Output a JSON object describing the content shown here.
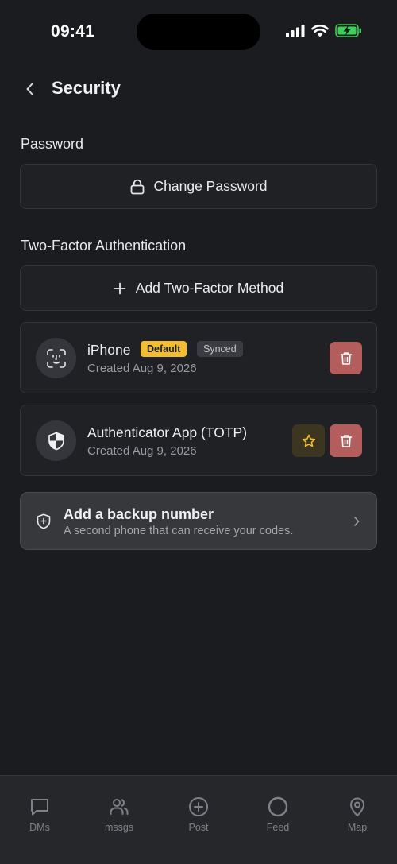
{
  "status_bar": {
    "time": "09:41"
  },
  "header": {
    "title": "Security"
  },
  "password_section": {
    "title": "Password",
    "change_password_label": "Change Password"
  },
  "two_factor_section": {
    "title": "Two-Factor Authentication",
    "add_method_label": "Add Two-Factor Method",
    "methods": [
      {
        "name": "iPhone",
        "created": "Created Aug 9, 2026",
        "badges": [
          "Default",
          "Synced"
        ],
        "icon": "face-id-icon"
      },
      {
        "name": "Authenticator App (TOTP)",
        "created": "Created Aug 9, 2026",
        "badges": [],
        "icon": "shield-icon"
      }
    ]
  },
  "backup": {
    "title": "Add a backup number",
    "subtitle": "A second phone that can receive your codes."
  },
  "tab_bar": {
    "items": [
      {
        "label": "DMs",
        "icon": "message-square-icon"
      },
      {
        "label": "mssgs",
        "icon": "users-icon"
      },
      {
        "label": "Post",
        "icon": "plus-circle-icon"
      },
      {
        "label": "Feed",
        "icon": "circle-icon"
      },
      {
        "label": "Map",
        "icon": "map-pin-icon"
      }
    ]
  },
  "colors": {
    "background": "#1b1c1f",
    "card": "#202125",
    "default_badge": "#f4bc2f",
    "delete_button": "#b35d5d",
    "battery": "#3ecf5a"
  }
}
